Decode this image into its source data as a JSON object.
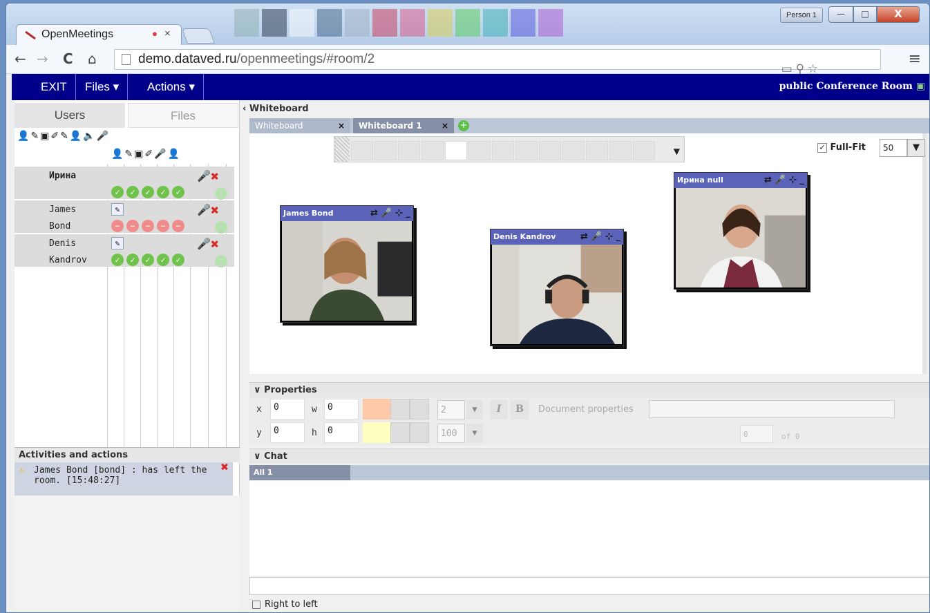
{
  "browser": {
    "person_label": "Person 1",
    "tab_title": "OpenMeetings",
    "tab_close": "×",
    "url_host": "demo.dataved.ru",
    "url_path": "/openmeetings/#room/2",
    "window_minimize": "—",
    "window_maximize": "□",
    "window_close": "X"
  },
  "menu": {
    "exit": "EXIT",
    "files": "Files ▾",
    "actions": "Actions ▾",
    "room_title": "public Conference Room"
  },
  "left": {
    "tab_users": "Users",
    "tab_files": "Files",
    "users": [
      {
        "line1": "Ирина",
        "line2": "",
        "badges": [
          "ok",
          "ok",
          "ok",
          "ok",
          "ok"
        ]
      },
      {
        "line1": "James",
        "line2": "Bond",
        "badges": [
          "no",
          "no",
          "no",
          "no",
          "no"
        ]
      },
      {
        "line1": "Denis",
        "line2": "Kandrov",
        "badges": [
          "ok",
          "ok",
          "ok",
          "ok",
          "ok"
        ]
      }
    ],
    "activities_title": "Activities and actions",
    "activity_text": "James Bond [bond] : has left the room. [15:48:27]"
  },
  "whiteboard": {
    "header": "Whiteboard",
    "tabs": [
      {
        "label": "Whiteboard",
        "close": "×"
      },
      {
        "label": "Whiteboard 1",
        "close": "×"
      }
    ],
    "full_fit_label": "Full-Fit",
    "zoom": "50",
    "videos": [
      {
        "name": "James Bond"
      },
      {
        "name": "Denis Kandrov"
      },
      {
        "name": "Ирина null"
      }
    ]
  },
  "properties": {
    "header": "Properties",
    "x_label": "x",
    "x_value": "0",
    "y_label": "y",
    "y_value": "0",
    "w_label": "w",
    "w_value": "0",
    "h_label": "h",
    "h_value": "0",
    "line_width": "2",
    "opacity": "100",
    "italic": "I",
    "bold": "B",
    "doc_properties": "Document properties",
    "page_number": "0",
    "of_pages": "of 0",
    "colors": {
      "stroke": "#ffc8a8",
      "fill": "#ffffc0"
    }
  },
  "chat": {
    "header": "Chat",
    "tab": "All 1",
    "rtl_label": "Right to left"
  }
}
